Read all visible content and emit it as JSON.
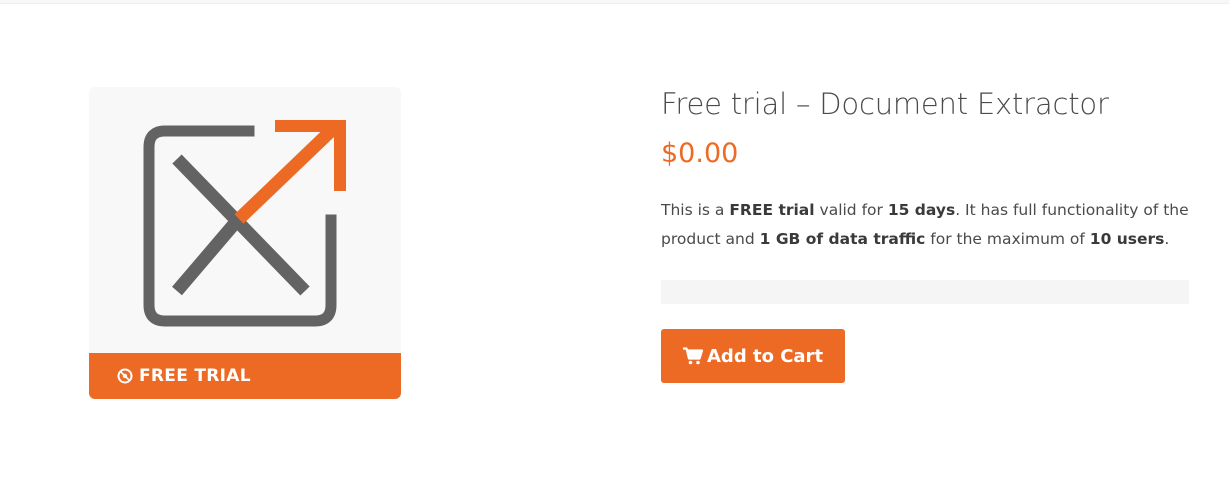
{
  "product": {
    "title": "Free trial – Document Extractor",
    "price": "$0.00",
    "banner_text": "FREE TRIAL",
    "description": {
      "t1": "This is a ",
      "b1": "FREE trial",
      "t2": " valid for ",
      "b2": "15 days",
      "t3": ". It has full functionality of the product and ",
      "b3": "1 GB of data traffic",
      "t4": " for the maximum of ",
      "b4": "10 users",
      "t5": "."
    },
    "add_to_cart_label": "Add to Cart"
  },
  "icons": {
    "logo": "document-extractor-logo",
    "badge": "badge-icon",
    "cart": "cart-icon"
  },
  "colors": {
    "accent": "#ec6a24",
    "logo_gray": "#636363",
    "text": "#4a4a4a"
  }
}
